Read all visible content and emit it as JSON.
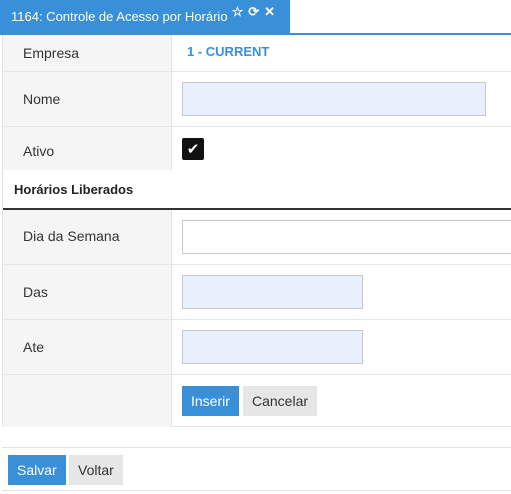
{
  "tab": {
    "title": "1164: Controle de Acesso por Horário",
    "icons": [
      "star-outline-icon",
      "refresh-icon",
      "close-icon"
    ],
    "color": "#3a8fd9"
  },
  "form": {
    "empresa": {
      "label": "Empresa",
      "value": "1 - CURRENT"
    },
    "nome": {
      "label": "Nome",
      "value": ""
    },
    "ativo": {
      "label": "Ativo",
      "checked": true,
      "check_glyph": "✔"
    }
  },
  "horarios": {
    "section_title": "Horários Liberados",
    "dia_da_semana": {
      "label": "Dia da Semana",
      "value": ""
    },
    "das": {
      "label": "Das",
      "value": ""
    },
    "ate": {
      "label": "Ate",
      "value": ""
    },
    "insert_label": "Inserir",
    "cancel_label": "Cancelar"
  },
  "footer": {
    "save_label": "Salvar",
    "back_label": "Voltar"
  }
}
